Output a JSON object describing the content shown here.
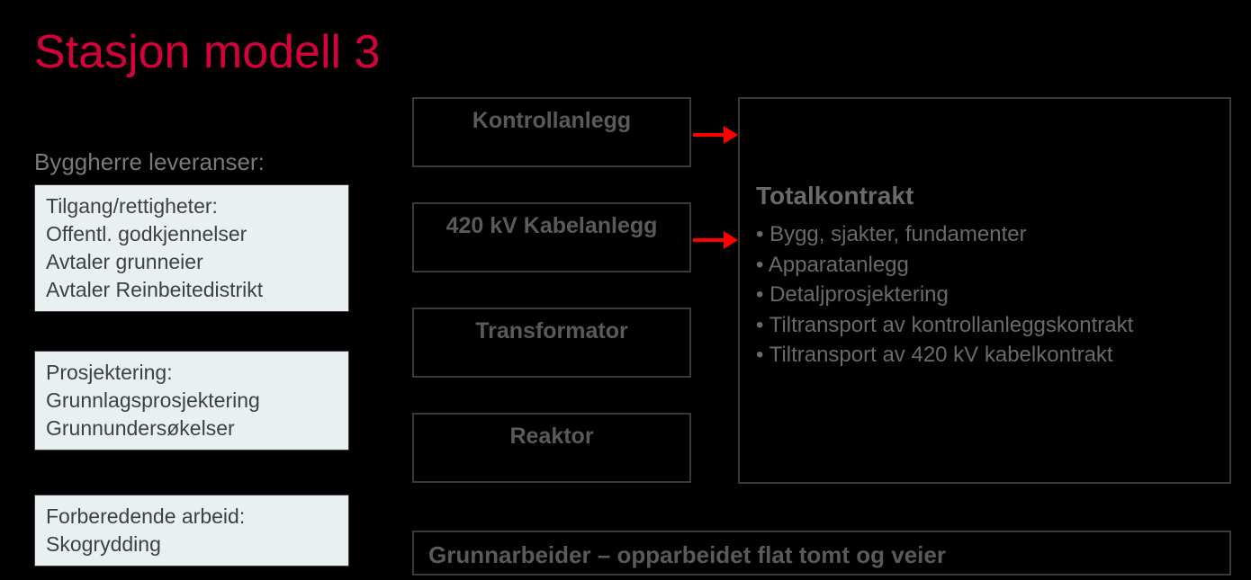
{
  "title": "Stasjon modell 3",
  "subheading": "Byggherre leveranser:",
  "leftBoxes": [
    {
      "lines": [
        "Tilgang/rettigheter:",
        "Offentl. godkjennelser",
        "Avtaler  grunneier",
        "Avtaler Reinbeitedistrikt"
      ]
    },
    {
      "lines": [
        "Prosjektering:",
        "Grunnlagsprosjektering",
        "Grunnundersøkelser"
      ]
    },
    {
      "lines": [
        "Forberedende arbeid:",
        "Skogrydding"
      ]
    }
  ],
  "midBoxes": [
    "Kontrollanlegg",
    "420 kV Kabelanlegg",
    "Transformator",
    "Reaktor"
  ],
  "rightBox": {
    "title": "Totalkontrakt",
    "items": [
      "Bygg, sjakter, fundamenter",
      "Apparatanlegg",
      "Detaljprosjektering",
      "Tiltransport av kontrollanleggskontrakt",
      "Tiltransport av 420 kV kabelkontrakt"
    ]
  },
  "bottomBox": "Grunnarbeider – opparbeidet flat tomt og veier"
}
